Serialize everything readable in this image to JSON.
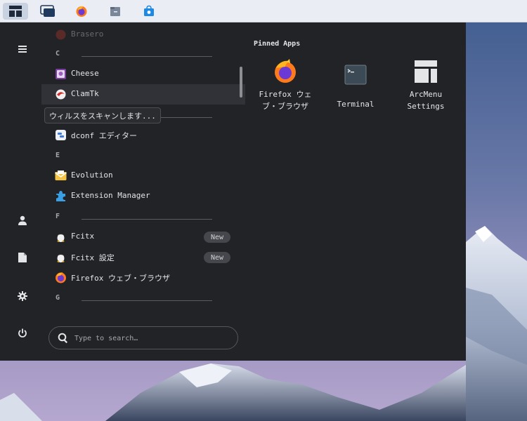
{
  "taskbar": {
    "items": [
      {
        "name": "arcmenu-button",
        "icon": "arcmenu-layout-icon",
        "active": true
      },
      {
        "name": "workspaces-button",
        "icon": "windows-icon"
      },
      {
        "name": "firefox-launcher",
        "icon": "firefox-icon"
      },
      {
        "name": "files-launcher",
        "icon": "file-cabinet-icon"
      },
      {
        "name": "software-launcher",
        "icon": "shopping-bag-icon"
      }
    ]
  },
  "sidebar": {
    "icons": [
      "hamburger-menu-icon",
      "user-icon",
      "document-icon",
      "gear-icon",
      "power-icon"
    ]
  },
  "app_list": {
    "partial_top_label": "Brasero",
    "sections": {
      "c": "C",
      "d": "D",
      "e": "E",
      "f": "F",
      "g": "G"
    },
    "apps": {
      "cheese": "Cheese",
      "clamtk": "ClamTk",
      "dconf": "dconf エディター",
      "evolution": "Evolution",
      "extension_manager": "Extension Manager",
      "fcitx": "Fcitx",
      "fcitx_settings": "Fcitx 設定",
      "firefox": "Firefox ウェブ・ブラウザ"
    },
    "badge_new": "New"
  },
  "tooltip": "ウィルスをスキャンします...",
  "search": {
    "placeholder": "Type to search…",
    "value": ""
  },
  "pinned": {
    "title": "Pinned Apps",
    "apps": [
      {
        "line1": "Firefox ウェ",
        "line2": "ブ・ブラウザ"
      },
      {
        "line1": "Terminal",
        "line2": ""
      },
      {
        "line1": "ArcMenu",
        "line2": "Settings"
      }
    ]
  },
  "colors": {
    "menu_bg": "#222327",
    "hover_row": "#313237",
    "panel_bg": "#eaedf3",
    "accent_blue": "#1e88e5"
  }
}
